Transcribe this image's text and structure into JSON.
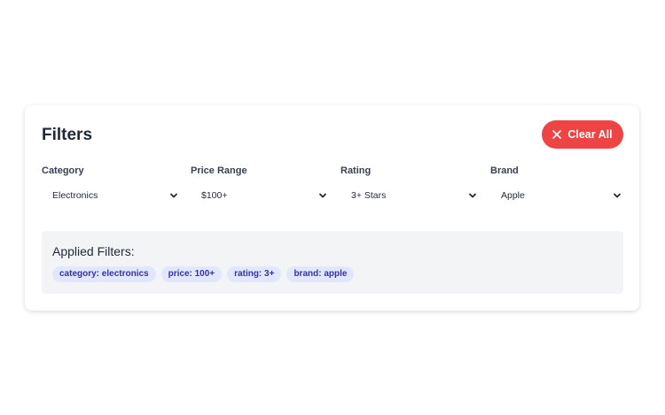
{
  "header": {
    "title": "Filters",
    "clear_all_label": "Clear All"
  },
  "filters": [
    {
      "label": "Category",
      "value": "Electronics"
    },
    {
      "label": "Price Range",
      "value": "$100+"
    },
    {
      "label": "Rating",
      "value": "3+ Stars"
    },
    {
      "label": "Brand",
      "value": "Apple"
    }
  ],
  "applied": {
    "title": "Applied Filters:",
    "chips": [
      "category: electronics",
      "price: 100+",
      "rating: 3+",
      "brand: apple"
    ]
  },
  "colors": {
    "accent_red": "#ef4444",
    "chip_bg": "#e0e7ff",
    "chip_text": "#3730a3",
    "panel_bg": "#f3f4f6"
  },
  "icons": {
    "clear": "close-icon",
    "dropdown": "chevron-down-icon"
  }
}
